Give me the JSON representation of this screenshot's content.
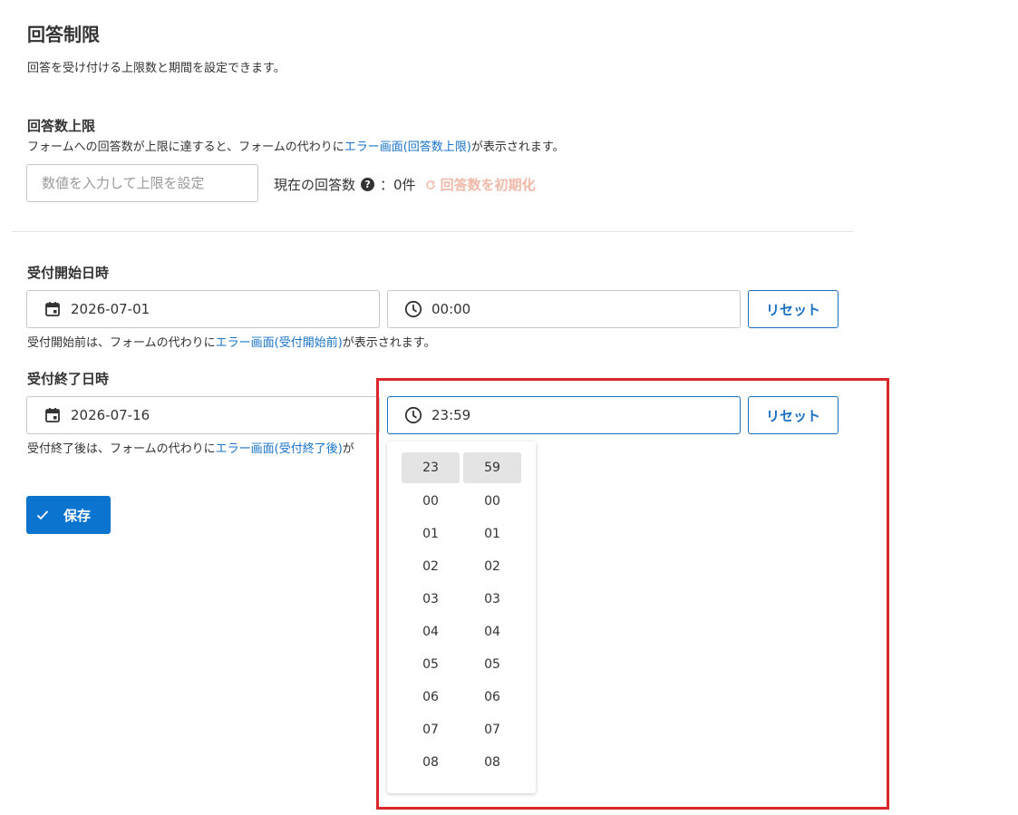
{
  "page": {
    "title": "回答制限",
    "description": "回答を受け付ける上限数と期間を設定できます。"
  },
  "limit": {
    "heading": "回答数上限",
    "desc_before": "フォームへの回答数が上限に達すると、フォームの代わりに",
    "desc_link": "エラー画面(回答数上限)",
    "desc_after": "が表示されます。",
    "input_placeholder": "数値を入力して上限を設定",
    "input_value": "",
    "current_label": "現在の回答数",
    "current_value": "：0件",
    "reset_count_label": "回答数を初期化",
    "help_icon": "question-circle-icon",
    "reset_icon": "refresh-icon"
  },
  "start": {
    "heading": "受付開始日時",
    "date": "2026-07-01",
    "time": "00:00",
    "reset_label": "リセット",
    "desc_before": "受付開始前は、フォームの代わりに",
    "desc_link": "エラー画面(受付開始前)",
    "desc_after": "が表示されます。"
  },
  "end": {
    "heading": "受付終了日時",
    "date": "2026-07-16",
    "time": "23:59",
    "reset_label": "リセット",
    "desc_before": "受付終了後は、フォームの代わりに",
    "desc_link": "エラー画面(受付終了後)",
    "desc_after": "が"
  },
  "save": {
    "label": "保存",
    "icon": "check-icon"
  },
  "time_picker": {
    "hours": [
      "23",
      "00",
      "01",
      "02",
      "03",
      "04",
      "05",
      "06",
      "07",
      "08"
    ],
    "minutes": [
      "59",
      "00",
      "01",
      "02",
      "03",
      "04",
      "05",
      "06",
      "07",
      "08"
    ],
    "selected_hour": "23",
    "selected_minute": "59"
  },
  "colors": {
    "accent": "#0b74cf",
    "link": "#1a73c7",
    "disabled_reset": "#f0b9a8",
    "highlight_border": "#d9262b"
  }
}
